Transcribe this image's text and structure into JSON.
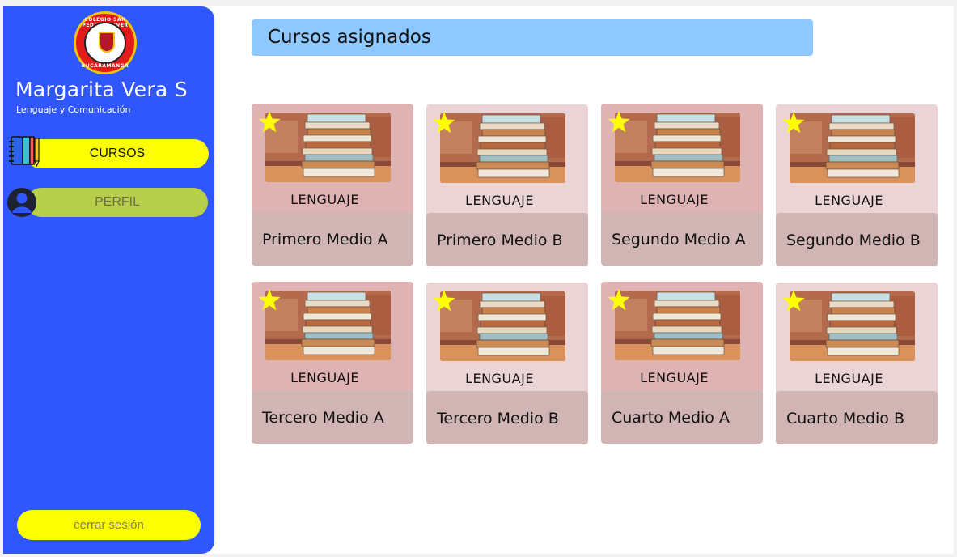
{
  "sidebar": {
    "logo": {
      "top_text": "COLEGIO SAN PEDRO CLAVER",
      "bottom_text": "BUCARAMANGA"
    },
    "user_name": "Margarita Vera S",
    "user_subject": "Lenguaje y Comunicación",
    "nav": [
      {
        "label": "CURSOS",
        "icon": "notebook-pencil-icon",
        "active": true
      },
      {
        "label": "PERFIL",
        "icon": "user-icon",
        "active": false
      }
    ],
    "logout_label": "cerrar sesión"
  },
  "main": {
    "title": "Cursos asignados",
    "courses": [
      {
        "subject": "LENGUAJE",
        "name": "Primero Medio A"
      },
      {
        "subject": "LENGUAJE",
        "name": "Primero Medio B"
      },
      {
        "subject": "LENGUAJE",
        "name": "Segundo Medio A"
      },
      {
        "subject": "LENGUAJE",
        "name": "Segundo Medio B"
      },
      {
        "subject": "LENGUAJE",
        "name": "Tercero Medio A"
      },
      {
        "subject": "LENGUAJE",
        "name": "Tercero Medio B"
      },
      {
        "subject": "LENGUAJE",
        "name": "Cuarto Medio A"
      },
      {
        "subject": "LENGUAJE",
        "name": "Cuarto Medio B"
      }
    ]
  },
  "colors": {
    "sidebar_bg": "#2f57fd",
    "active_nav": "#fbff00",
    "inactive_nav": "#b8cf4c",
    "header_bar": "#8fc8ff",
    "card_top_dark": "#dfb3b4",
    "card_top_light": "#ebd4d5",
    "card_bottom": "#d0b5b4",
    "star": "#ffff00"
  }
}
